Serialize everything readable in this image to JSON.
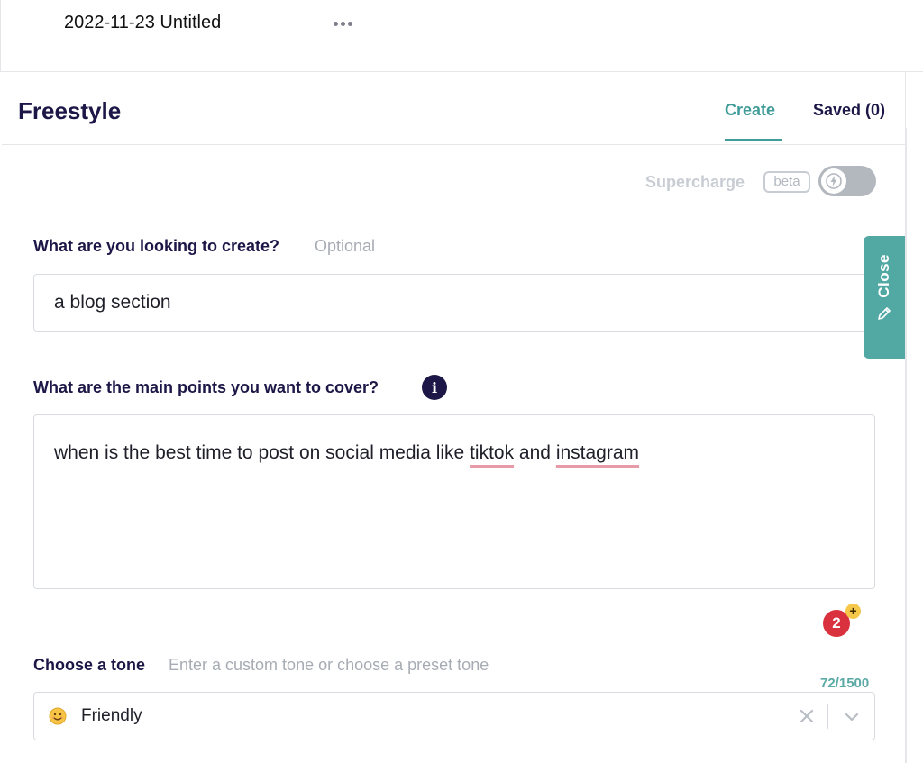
{
  "document": {
    "title": "2022-11-23 Untitled"
  },
  "panel": {
    "title": "Freestyle",
    "tabs": [
      {
        "label": "Create",
        "active": true
      },
      {
        "label": "Saved (0)",
        "active": false
      }
    ]
  },
  "supercharge": {
    "label": "Supercharge",
    "badge": "beta",
    "enabled": false
  },
  "create_field": {
    "label": "What are you looking to create?",
    "hint": "Optional",
    "value": "a blog section"
  },
  "points_field": {
    "label": "What are the main points you want to cover?",
    "info_glyph": "i",
    "value_parts": [
      "when is the best time to post on social media like ",
      "tiktok",
      " and ",
      "instagram"
    ],
    "issues_count": "2",
    "issues_plus": "+",
    "char_count": "72/1500"
  },
  "tone_field": {
    "label": "Choose a tone",
    "hint": "Enter a custom tone or choose a preset tone",
    "value": "Friendly",
    "emoji_icon": "smiley-face-icon"
  },
  "close_tab": {
    "label": "Close"
  },
  "colors": {
    "accent": "#3f9c98",
    "navy": "#1d1747",
    "error": "#d9313d",
    "warning": "#f5c84a"
  }
}
